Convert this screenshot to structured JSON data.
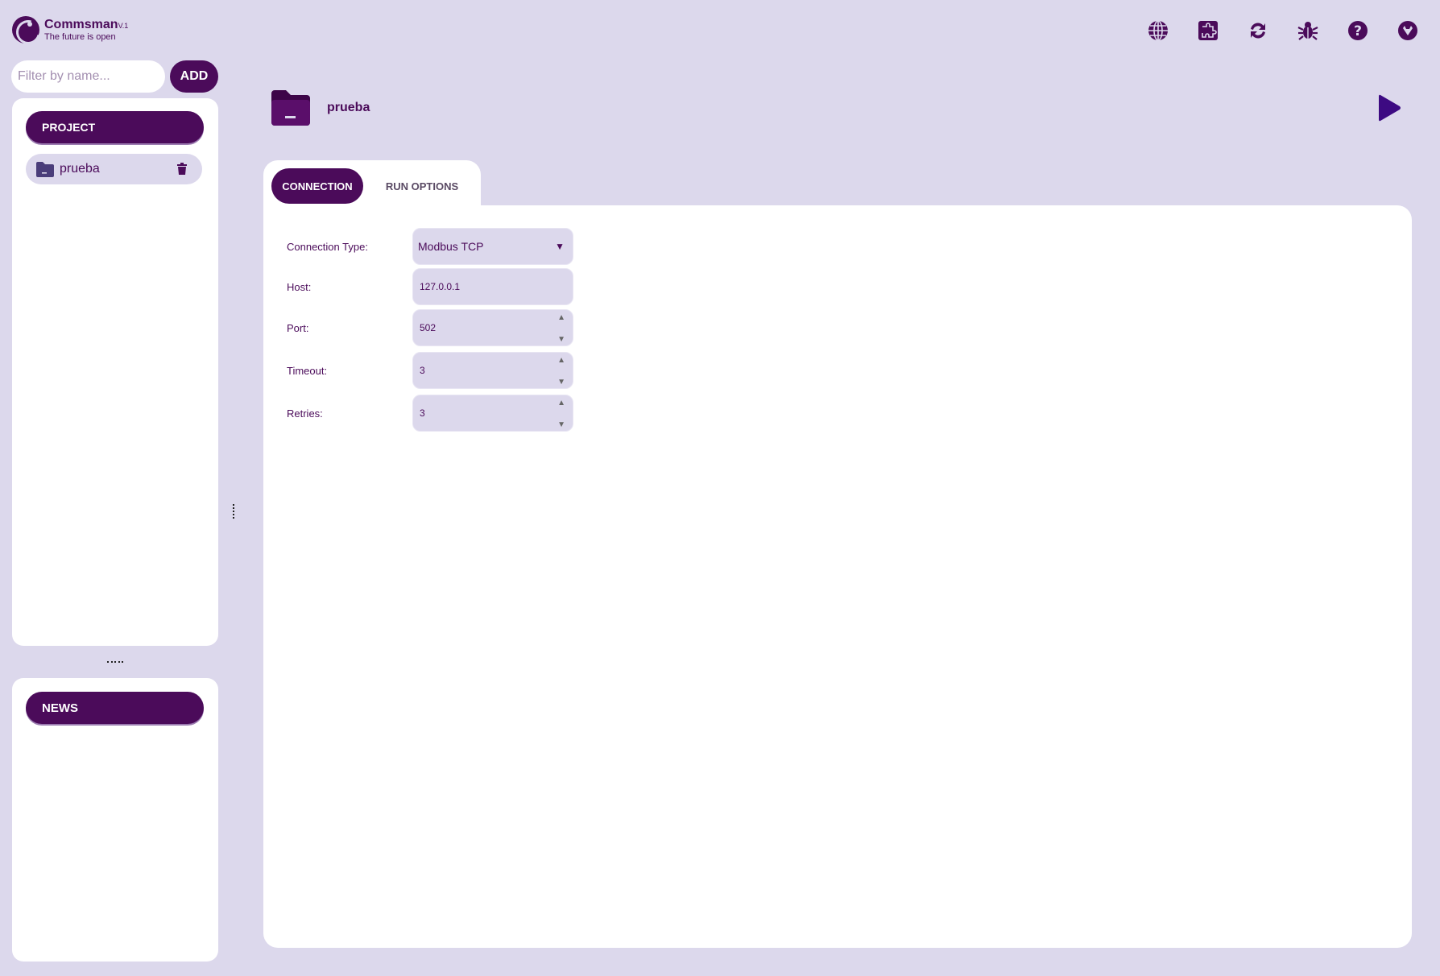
{
  "app": {
    "name": "Commsman",
    "version": "V.1",
    "tagline": "The future is open"
  },
  "header_icons": [
    "globe-icon",
    "puzzle-icon",
    "refresh-icon",
    "bug-icon",
    "help-icon",
    "gitlab-icon"
  ],
  "sidebar": {
    "filter_placeholder": "Filter by name...",
    "filter_value": "",
    "add_label": "ADD",
    "projects_header": "PROJECT",
    "projects": [
      {
        "name": "prueba"
      }
    ],
    "news_header": "NEWS"
  },
  "main": {
    "project_title": "prueba",
    "tabs": [
      {
        "label": "CONNECTION",
        "active": true
      },
      {
        "label": "RUN OPTIONS",
        "active": false
      }
    ],
    "form": {
      "connection_type_label": "Connection Type:",
      "connection_type_value": "Modbus TCP",
      "host_label": "Host:",
      "host_value": "127.0.0.1",
      "port_label": "Port:",
      "port_value": "502",
      "timeout_label": "Timeout:",
      "timeout_value": "3",
      "retries_label": "Retries:",
      "retries_value": "3"
    }
  },
  "colors": {
    "background": "#dcd8ec",
    "accent": "#4b0b5a",
    "panel": "#ffffff"
  }
}
